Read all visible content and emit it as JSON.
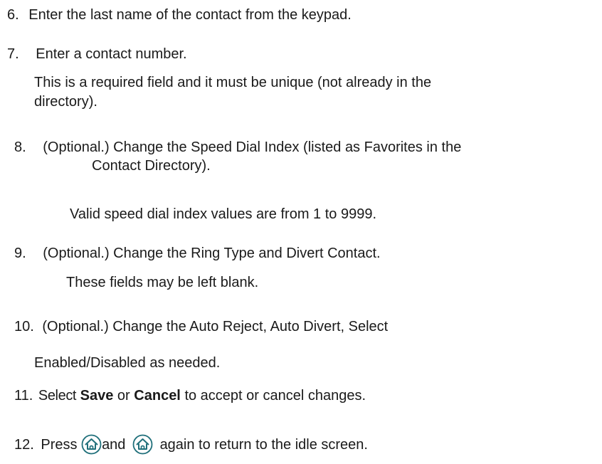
{
  "steps": [
    {
      "number": "6.",
      "text": "Enter the last name of the contact from the keypad."
    },
    {
      "number": "7.",
      "text": "Enter a contact number.",
      "note_line1": "This is a required field and it must be unique (not already in the",
      "note_line2": "directory)."
    },
    {
      "number": "8.",
      "text_line1": "(Optional.) Change the Speed Dial Index (listed as Favorites in the",
      "text_line2": "Contact Directory).",
      "note": "Valid speed dial index values are from 1 to 9999."
    },
    {
      "number": "9.",
      "text": "(Optional.) Change the Ring Type and Divert Contact.",
      "note": "These fields may be left blank."
    },
    {
      "number": "10.",
      "text_line1": "(Optional.) Change the Auto Reject, Auto Divert, Select",
      "text_line2": "Enabled/Disabled as needed."
    },
    {
      "number": "11.",
      "prefix": "Select",
      "save": "Save",
      "or": "or",
      "cancel": "Cancel",
      "suffix": "to accept or cancel changes."
    },
    {
      "number": "12.",
      "prefix": "Press",
      "middle": "and",
      "suffix": "again to return to the idle screen.",
      "icon": "home-icon"
    }
  ]
}
